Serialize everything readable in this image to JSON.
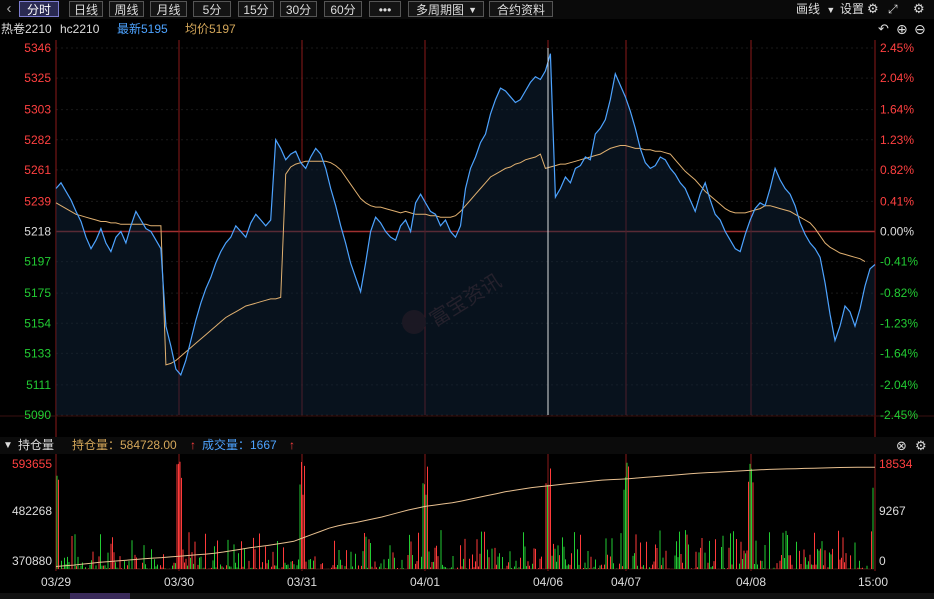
{
  "toolbar": {
    "prev_arrow": "‹",
    "tabs": [
      "分时",
      "日线",
      "周线",
      "月线",
      "5分",
      "15分",
      "30分",
      "60分"
    ],
    "more": "•••",
    "multi_period": "多周期图",
    "contract_info": "合约资料",
    "draw": "画线",
    "settings": "设置",
    "icons": [
      "caret-down-icon",
      "gear-icon",
      "expand-icon"
    ]
  },
  "info": {
    "name": "热卷2210",
    "code": "hc2210",
    "latest_label": "最新5195",
    "avg_label": "均价5197",
    "icons": [
      "back-icon",
      "zoom-in-icon",
      "zoom-out-icon"
    ]
  },
  "volume_bar": {
    "title": "持仓量",
    "oi_label": "持仓量：584728.00",
    "vol_label": "成交量：1667",
    "up_arrow": "↑"
  },
  "watermark": "富宝资讯",
  "colors": {
    "price": "#4da3ff",
    "avg": "#e0b070",
    "up": "#ff3a3a",
    "down": "#22cc33",
    "grid": "#8b1a1a",
    "label_blue": "#4da3ff",
    "label_gold": "#d4a75a"
  },
  "chart_data": {
    "type": "line",
    "title": "",
    "price_axis": {
      "ticks": [
        5346,
        5325,
        5303,
        5282,
        5261,
        5239,
        5218,
        5197,
        5175,
        5154,
        5133,
        5111,
        5090
      ],
      "ylim": [
        5090,
        5346
      ],
      "base": 5218
    },
    "pct_axis": {
      "ticks": [
        "2.45%",
        "2.04%",
        "1.64%",
        "1.23%",
        "0.82%",
        "0.41%",
        "0.00%",
        "-0.41%",
        "-0.82%",
        "-1.23%",
        "-1.64%",
        "-2.04%",
        "-2.45%"
      ]
    },
    "sessions": [
      "03/29",
      "03/30",
      "03/31",
      "04/01",
      "04/06",
      "04/07",
      "04/08",
      "15:00"
    ],
    "price_series": {
      "name": "最新",
      "values": [
        5248,
        5252,
        5246,
        5240,
        5232,
        5225,
        5214,
        5206,
        5212,
        5220,
        5210,
        5204,
        5214,
        5218,
        5210,
        5222,
        5232,
        5226,
        5220,
        5218,
        5212,
        5206,
        5152,
        5138,
        5122,
        5118,
        5128,
        5142,
        5156,
        5168,
        5178,
        5186,
        5196,
        5204,
        5210,
        5214,
        5222,
        5218,
        5214,
        5224,
        5230,
        5226,
        5222,
        5226,
        5282,
        5276,
        5268,
        5272,
        5274,
        5266,
        5262,
        5270,
        5276,
        5272,
        5262,
        5248,
        5236,
        5222,
        5210,
        5196,
        5186,
        5176,
        5196,
        5218,
        5228,
        5224,
        5218,
        5214,
        5212,
        5222,
        5226,
        5218,
        5238,
        5244,
        5238,
        5232,
        5230,
        5222,
        5226,
        5218,
        5214,
        5222,
        5248,
        5262,
        5270,
        5280,
        5286,
        5300,
        5310,
        5318,
        5316,
        5312,
        5308,
        5310,
        5316,
        5322,
        5326,
        5324,
        5330,
        5342,
        5242,
        5248,
        5256,
        5252,
        5262,
        5264,
        5270,
        5268,
        5286,
        5290,
        5296,
        5310,
        5328,
        5320,
        5312,
        5302,
        5290,
        5276,
        5266,
        5262,
        5264,
        5270,
        5268,
        5262,
        5258,
        5252,
        5248,
        5240,
        5232,
        5244,
        5252,
        5240,
        5230,
        5226,
        5218,
        5212,
        5206,
        5204,
        5216,
        5226,
        5234,
        5238,
        5236,
        5248,
        5262,
        5254,
        5248,
        5244,
        5236,
        5224,
        5216,
        5210,
        5206,
        5200,
        5182,
        5160,
        5142,
        5152,
        5166,
        5162,
        5152,
        5164,
        5180,
        5192,
        5195
      ]
    },
    "avg_series": {
      "name": "均价",
      "values": [
        5238,
        5236,
        5234,
        5232,
        5230,
        5229,
        5228,
        5227,
        5226,
        5225,
        5225,
        5224,
        5224,
        5223,
        5223,
        5223,
        5223,
        5223,
        5223,
        5222,
        5222,
        5222,
        5125,
        5126,
        5128,
        5131,
        5134,
        5137,
        5140,
        5143,
        5146,
        5149,
        5152,
        5155,
        5158,
        5160,
        5162,
        5164,
        5166,
        5167,
        5168,
        5169,
        5170,
        5171,
        5171,
        5172,
        5258,
        5263,
        5265,
        5266,
        5267,
        5267,
        5267,
        5267,
        5267,
        5266,
        5264,
        5261,
        5256,
        5251,
        5246,
        5241,
        5238,
        5236,
        5235,
        5235,
        5234,
        5233,
        5232,
        5231,
        5232,
        5231,
        5230,
        5230,
        5230,
        5229,
        5229,
        5228,
        5228,
        5228,
        5229,
        5232,
        5236,
        5240,
        5244,
        5248,
        5252,
        5256,
        5258,
        5260,
        5262,
        5263,
        5265,
        5266,
        5268,
        5269,
        5270,
        5272,
        5262,
        5263,
        5264,
        5265,
        5265,
        5266,
        5267,
        5268,
        5269,
        5270,
        5271,
        5272,
        5274,
        5276,
        5277,
        5278,
        5278,
        5277,
        5276,
        5276,
        5275,
        5275,
        5274,
        5274,
        5273,
        5272,
        5268,
        5264,
        5260,
        5257,
        5254,
        5250,
        5246,
        5243,
        5240,
        5237,
        5234,
        5232,
        5231,
        5231,
        5231,
        5232,
        5233,
        5234,
        5236,
        5236,
        5235,
        5234,
        5233,
        5232,
        5230,
        5228,
        5226,
        5224,
        5220,
        5215,
        5210,
        5207,
        5205,
        5203,
        5202,
        5201,
        5200,
        5199,
        5197
      ]
    },
    "open_interest": {
      "name": "持仓量",
      "axis_ticks": [
        593655,
        482268,
        370880
      ],
      "ylim": [
        370880,
        593655
      ],
      "values": [
        372000,
        373500,
        375000,
        377000,
        379000,
        381000,
        382500,
        384000,
        385500,
        387000,
        388500,
        390000,
        391000,
        392500,
        394000,
        395500,
        397000,
        398500,
        400500,
        403000,
        406000,
        409000,
        412000,
        414500,
        417000,
        420000,
        423000,
        426000,
        433000,
        440000,
        447000,
        454000,
        459000,
        463000,
        466000,
        470000,
        474000,
        478000,
        483000,
        488000,
        493000,
        497000,
        501000,
        503500,
        506000,
        508500,
        512000,
        516000,
        520000,
        524000,
        528000,
        532000,
        535000,
        538000,
        541000,
        543000,
        545000,
        547000,
        549000,
        551000,
        553000,
        555000,
        557000,
        558000,
        559000,
        560000,
        561500,
        563000,
        564500,
        566000,
        567500,
        569000,
        570500,
        572000,
        573000,
        574000,
        575000,
        576000,
        577000,
        578000,
        579000,
        580000,
        580500,
        581000,
        581500,
        582000,
        582500,
        583000,
        583500,
        584000,
        584300,
        584500,
        584600,
        584728
      ]
    },
    "volume": {
      "name": "成交量",
      "axis_ticks": [
        18534,
        9267,
        0
      ],
      "ylim": [
        0,
        18534
      ]
    }
  }
}
